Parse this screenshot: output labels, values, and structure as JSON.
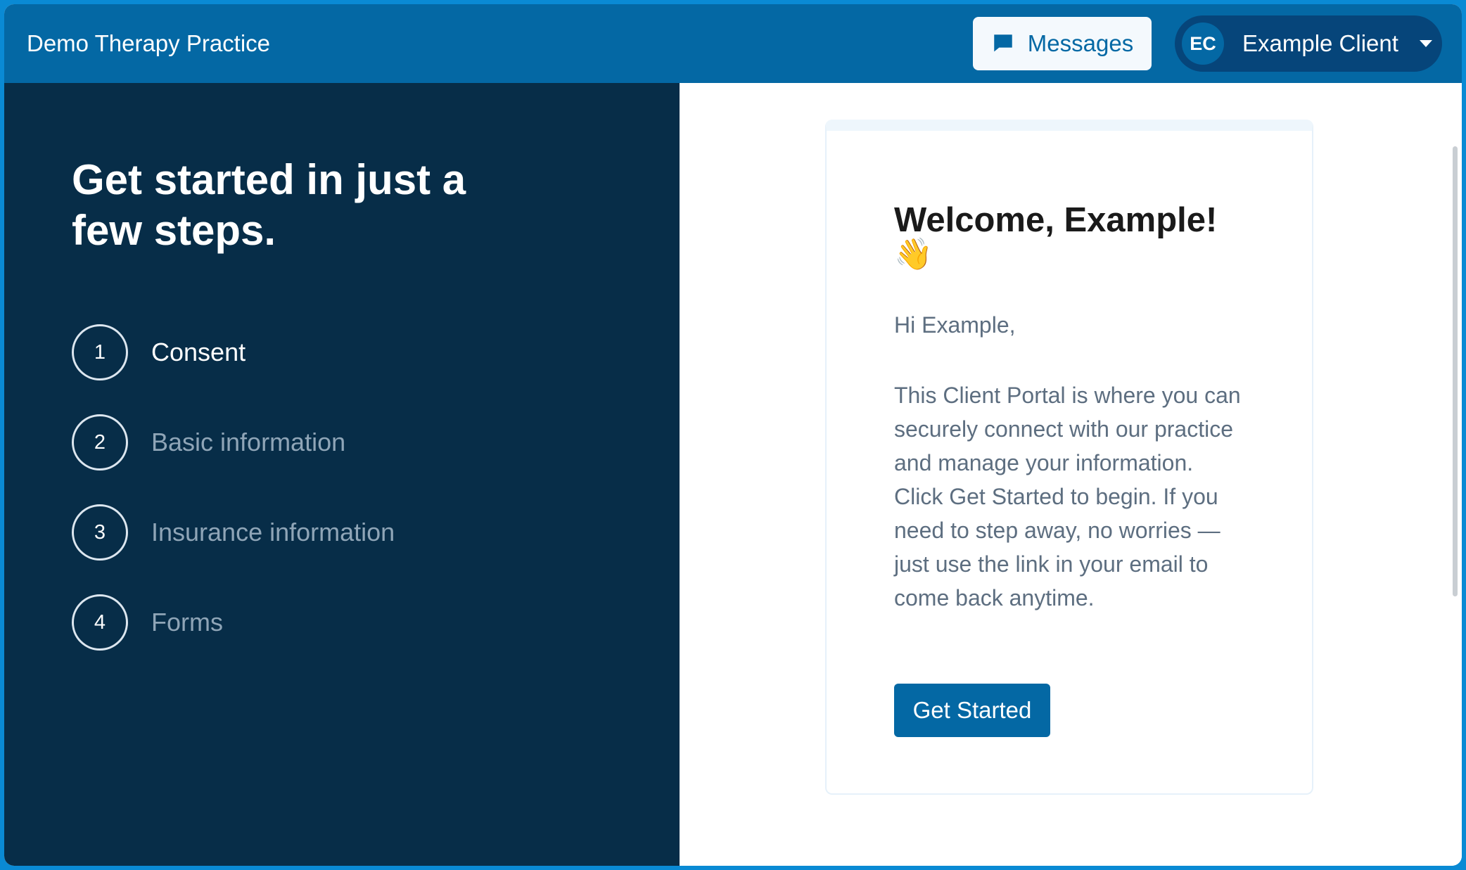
{
  "header": {
    "practice_name": "Demo Therapy Practice",
    "messages_label": "Messages",
    "user_initials": "EC",
    "user_name": "Example Client"
  },
  "onboarding": {
    "title": "Get started in just a few steps.",
    "steps": [
      {
        "number": "1",
        "label": "Consent",
        "active": true
      },
      {
        "number": "2",
        "label": "Basic information",
        "active": false
      },
      {
        "number": "3",
        "label": "Insurance information",
        "active": false
      },
      {
        "number": "4",
        "label": "Forms",
        "active": false
      }
    ]
  },
  "welcome_card": {
    "title": "Welcome, Example!",
    "emoji": "👋",
    "greeting": "Hi Example,",
    "body": "This Client Portal is where you can securely connect with our practice and manage your information. Click Get Started to begin. If you need to step away, no worries — just use the link in your email to come back anytime.",
    "button_label": "Get Started"
  },
  "colors": {
    "header_bg": "#0468a4",
    "sidebar_bg": "#072d48",
    "primary": "#0468a4",
    "outer_border": "#0a8ad4"
  },
  "icons": {
    "messages": "chat-bubble-icon",
    "user_menu": "caret-down-icon"
  }
}
